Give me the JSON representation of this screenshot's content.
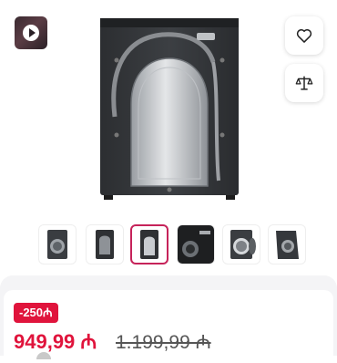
{
  "video": {
    "icon": "play-icon"
  },
  "actions": {
    "favorite_icon": "heart-icon",
    "compare_icon": "scales-icon"
  },
  "gallery": {
    "thumbnails": [
      {
        "kind": "front-gray"
      },
      {
        "kind": "back-dark"
      },
      {
        "kind": "back-selected",
        "active": true
      },
      {
        "kind": "drum-closeup"
      },
      {
        "kind": "open-door"
      },
      {
        "kind": "angle-view"
      }
    ]
  },
  "price": {
    "discount": "-250₼",
    "current": "949,99 ₼",
    "old": "1.199,99 ₼"
  },
  "colors": {
    "accent": "#e0143c",
    "selected_border": "#c6235a",
    "panel_bg": "#f4f4f6"
  }
}
